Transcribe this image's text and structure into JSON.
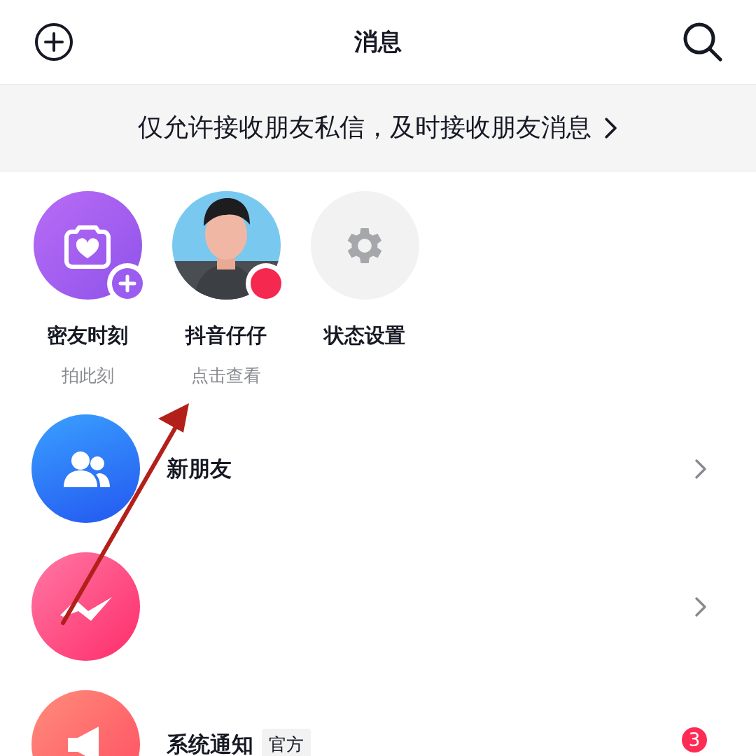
{
  "header": {
    "title": "消息"
  },
  "banner": {
    "text": "仅允许接收朋友私信，及时接收朋友消息"
  },
  "stories": [
    {
      "kind": "moment",
      "name": "密友时刻",
      "caption": "拍此刻"
    },
    {
      "kind": "avatar",
      "name": "抖音仔仔",
      "caption": "点击查看"
    },
    {
      "kind": "settings",
      "name": "状态设置"
    }
  ],
  "conversations": [
    {
      "kind": "friends",
      "title": "新朋友"
    },
    {
      "kind": "interactions"
    },
    {
      "kind": "system",
      "title": "系统通知",
      "tag": "官方",
      "badge": "3"
    }
  ]
}
